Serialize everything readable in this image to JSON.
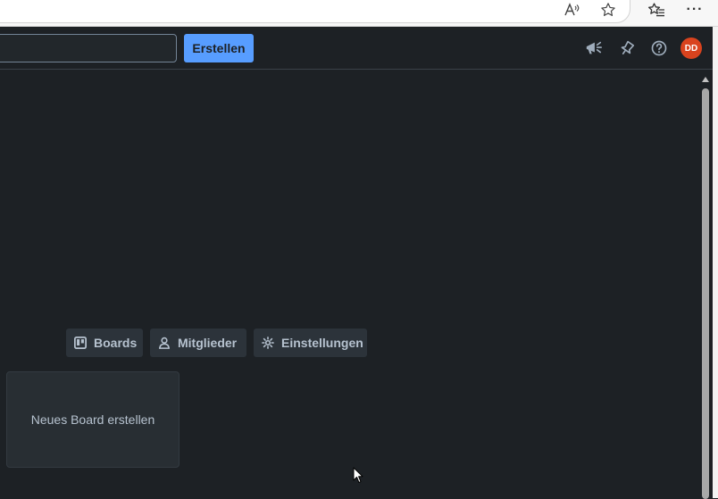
{
  "browser": {
    "icons": [
      "read-aloud-icon",
      "favorite-star-icon",
      "favorites-list-icon",
      "more-menu-icon"
    ],
    "read_aloud_glyph": "A",
    "more_glyph": "···"
  },
  "header": {
    "search": {
      "placeholder": "",
      "value": ""
    },
    "create_label": "Erstellen",
    "icons": [
      "announcement-icon",
      "notifications-icon",
      "help-icon"
    ],
    "avatar_initials": "DD",
    "avatar_color": "#d9431e",
    "accent_color": "#579dff"
  },
  "workspace": {
    "tabs": [
      {
        "label": "Boards",
        "icon": "board-icon"
      },
      {
        "label": "Mitglieder",
        "icon": "person-icon"
      },
      {
        "label": "Einstellungen",
        "icon": "gear-icon"
      }
    ],
    "new_board_label": "Neues Board erstellen"
  },
  "theme": {
    "background": "#1d2125",
    "tile_background": "#282e33",
    "text": "#b6c2cf"
  }
}
